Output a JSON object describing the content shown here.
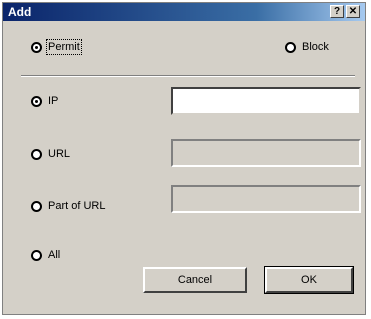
{
  "window": {
    "title": "Add",
    "help_label": "?",
    "close_label": "✕"
  },
  "top_options": {
    "permit": "Permit",
    "block": "Block"
  },
  "match_options": {
    "ip": "IP",
    "url": "URL",
    "part_of_url": "Part of URL",
    "all": "All"
  },
  "inputs": {
    "ip_value": "",
    "url_value": "",
    "part_of_url_value": ""
  },
  "buttons": {
    "cancel": "Cancel",
    "ok": "OK"
  }
}
